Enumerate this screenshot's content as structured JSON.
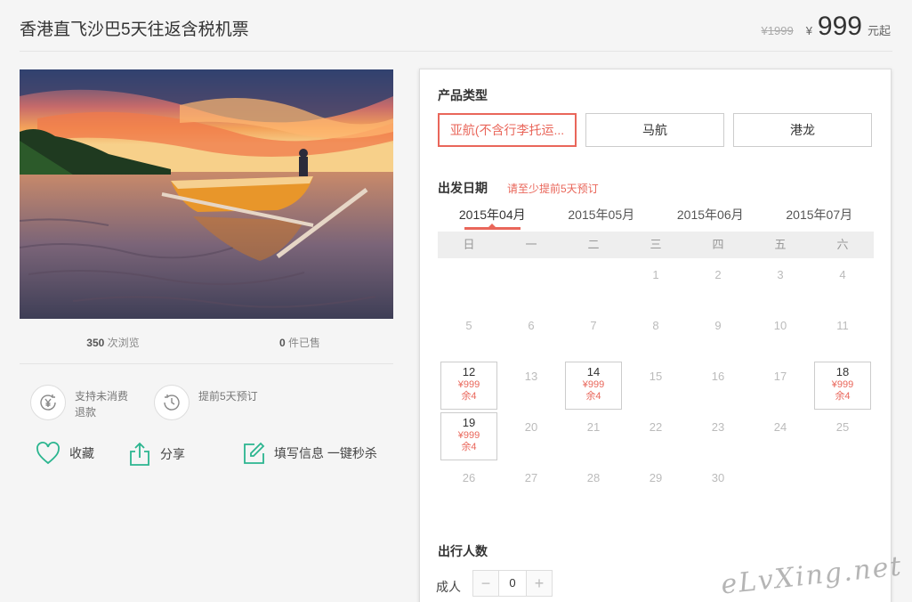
{
  "title": "香港直飞沙巴5天往返含税机票",
  "price": {
    "original": "¥1999",
    "yen": "¥",
    "current": "999",
    "unit": "元起"
  },
  "stats": {
    "views_count": "350",
    "views_label": "次浏览",
    "sold_count": "0",
    "sold_label": "件已售"
  },
  "features": [
    {
      "icon": "yen-refund-icon",
      "text": "支持未消费退款"
    },
    {
      "icon": "clock-icon",
      "text": "提前5天预订"
    }
  ],
  "actions": {
    "favorite": "收藏",
    "share": "分享",
    "quick_fill": "填写信息 一键秒杀"
  },
  "product_type": {
    "label": "产品类型",
    "options": [
      "亚航(不含行李托运...",
      "马航",
      "港龙"
    ],
    "selected": 0
  },
  "departure": {
    "label": "出发日期",
    "note": "请至少提前5天预订"
  },
  "months": [
    "2015年04月",
    "2015年05月",
    "2015年06月",
    "2015年07月"
  ],
  "active_month": 0,
  "weekdays": [
    "日",
    "一",
    "二",
    "三",
    "四",
    "五",
    "六"
  ],
  "calendar": {
    "first_weekday": 3,
    "days_in_month": 30,
    "available": {
      "12": {
        "price": "¥999",
        "left": "余4"
      },
      "14": {
        "price": "¥999",
        "left": "余4"
      },
      "18": {
        "price": "¥999",
        "left": "余4"
      },
      "19": {
        "price": "¥999",
        "left": "余4"
      }
    }
  },
  "travelers": {
    "label": "出行人数",
    "adult_label": "成人",
    "minus": "−",
    "plus": "+",
    "value": "0"
  },
  "watermark": "eLvXing.net",
  "colors": {
    "accent": "#e9665a",
    "icon_green": "#2bb58f"
  }
}
